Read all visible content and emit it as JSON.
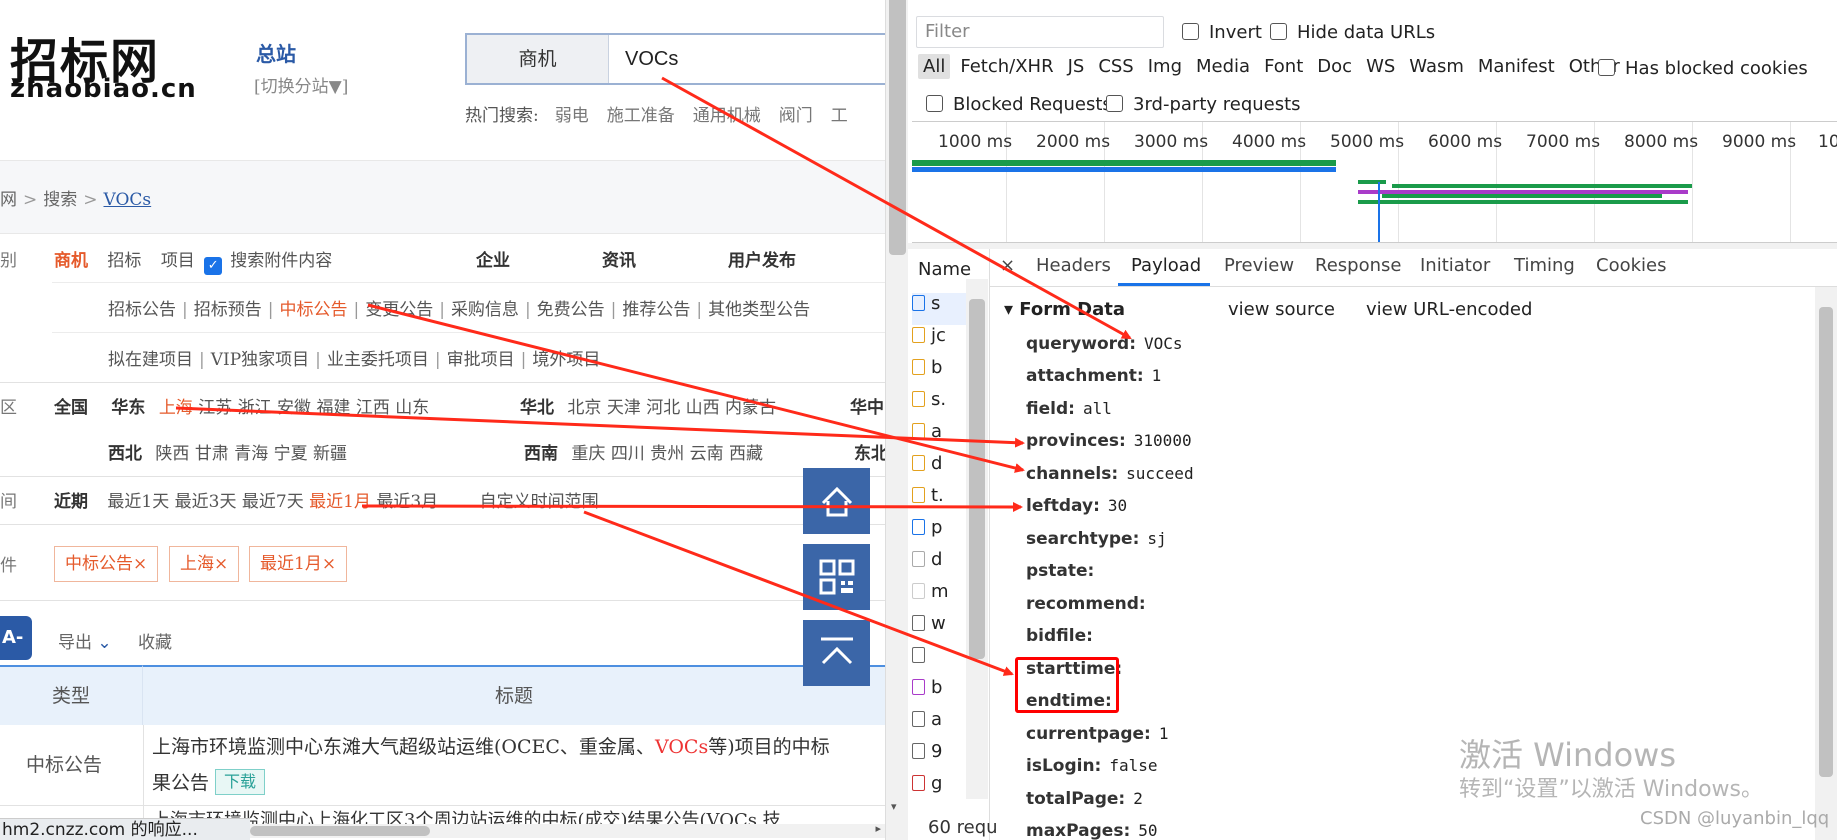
{
  "site": {
    "logo_cn": "招标网",
    "logo_en": "zhaobiao.cn",
    "station": "总站",
    "switch_station": "[切换分站▼]",
    "search_category": "商机",
    "search_value": "VOCs",
    "hot_label": "热门搜索:",
    "hot_terms": [
      "弱电",
      "施工准备",
      "通用机械",
      "阀门",
      "工"
    ],
    "breadcrumb": [
      "网",
      "搜索",
      "VOCs"
    ],
    "type_row": {
      "label": "别",
      "active": "商机",
      "items": [
        "招标",
        "项目"
      ],
      "attach": "搜索附件内容",
      "bold_items": [
        "企业",
        "资讯",
        "用户发布"
      ]
    },
    "sub_row1": [
      "招标公告",
      "招标预告",
      "中标公告",
      "变更公告",
      "采购信息",
      "免费公告",
      "推荐公告",
      "其他类型公告"
    ],
    "sub_row2": [
      "拟在建项目",
      "VIP独家项目",
      "业主委托项目",
      "审批项目",
      "境外项目"
    ],
    "region": {
      "label": "区",
      "all": "全国",
      "east_label": "华东",
      "east": [
        "上海",
        "江苏",
        "浙江",
        "安徽",
        "福建",
        "江西",
        "山东"
      ],
      "north_label": "华北",
      "north": [
        "北京",
        "天津",
        "河北",
        "山西",
        "内蒙古"
      ],
      "central_label": "华中",
      "nw_label": "西北",
      "nw": [
        "陕西",
        "甘肃",
        "青海",
        "宁夏",
        "新疆"
      ],
      "sw_label": "西南",
      "sw": [
        "重庆",
        "四川",
        "贵州",
        "云南",
        "西藏"
      ],
      "ne_label": "东北"
    },
    "time": {
      "label": "间",
      "recent": "近期",
      "items": [
        "最近1天",
        "最近3天",
        "最近7天",
        "最近1月",
        "最近3月"
      ],
      "custom": "自定义时间范围"
    },
    "conditions_label": "件",
    "tags": [
      "中标公告×",
      "上海×",
      "最近1月×"
    ],
    "a_button": "A-",
    "export": "导出",
    "collect": "收藏",
    "table_headers": [
      "类型",
      "标题"
    ],
    "row1_type": "中标公告",
    "row1_title_a": "上海市环境监测中心东滩大气超级站运维(OCEC、重金属、",
    "row1_title_hl": "VOCs",
    "row1_title_b": "等)项目的中标",
    "row1_title_c": "果公告",
    "row1_download": "下载",
    "row2_partial": "上海市环境监测中心上海化工区3个周边站运维的中标(成交)结果公告(VOCs 技",
    "status_text": "hm2.cnzz.com 的响应..."
  },
  "devtools": {
    "filter_placeholder": "Filter",
    "invert": "Invert",
    "hide_data_urls": "Hide data URLs",
    "types": [
      "All",
      "Fetch/XHR",
      "JS",
      "CSS",
      "Img",
      "Media",
      "Font",
      "Doc",
      "WS",
      "Wasm",
      "Manifest",
      "Other"
    ],
    "has_blocked_cookies": "Has blocked cookies",
    "blocked_requests": "Blocked Requests",
    "third_party": "3rd-party requests",
    "ticks": [
      "1000 ms",
      "2000 ms",
      "3000 ms",
      "4000 ms",
      "5000 ms",
      "6000 ms",
      "7000 ms",
      "8000 ms",
      "9000 ms",
      "10"
    ],
    "name_header": "Name",
    "name_rows": [
      "s",
      "jc",
      "b",
      "s.",
      "a",
      "d",
      "t.",
      "p",
      "d",
      "m",
      "w",
      "",
      "b",
      "a",
      "9",
      "g"
    ],
    "req_count": "60 requ",
    "tabs": [
      "×",
      "Headers",
      "Payload",
      "Preview",
      "Response",
      "Initiator",
      "Timing",
      "Cookies"
    ],
    "active_tab": "Payload",
    "form_data_header": "▾ Form Data",
    "view_source": "view source",
    "view_url_encoded": "view URL-encoded",
    "form_data": [
      {
        "k": "queryword:",
        "v": "VOCs"
      },
      {
        "k": "attachment:",
        "v": "1"
      },
      {
        "k": "field:",
        "v": "all"
      },
      {
        "k": "provinces:",
        "v": "310000"
      },
      {
        "k": "channels:",
        "v": "succeed"
      },
      {
        "k": "leftday:",
        "v": "30"
      },
      {
        "k": "searchtype:",
        "v": "sj"
      },
      {
        "k": "pstate:",
        "v": ""
      },
      {
        "k": "recommend:",
        "v": ""
      },
      {
        "k": "bidfile:",
        "v": ""
      },
      {
        "k": "starttime:",
        "v": ""
      },
      {
        "k": "endtime:",
        "v": ""
      },
      {
        "k": "currentpage:",
        "v": "1"
      },
      {
        "k": "isLogin:",
        "v": "false"
      },
      {
        "k": "totalPage:",
        "v": "2"
      },
      {
        "k": "maxPages:",
        "v": "50"
      }
    ]
  },
  "overlay": {
    "watermark_line1": "激活 Windows",
    "watermark_line2": "转到“设置”以激活 Windows。",
    "credit": "CSDN @luyanbin_lqq",
    "annotation_color": "#ff2a1a"
  }
}
